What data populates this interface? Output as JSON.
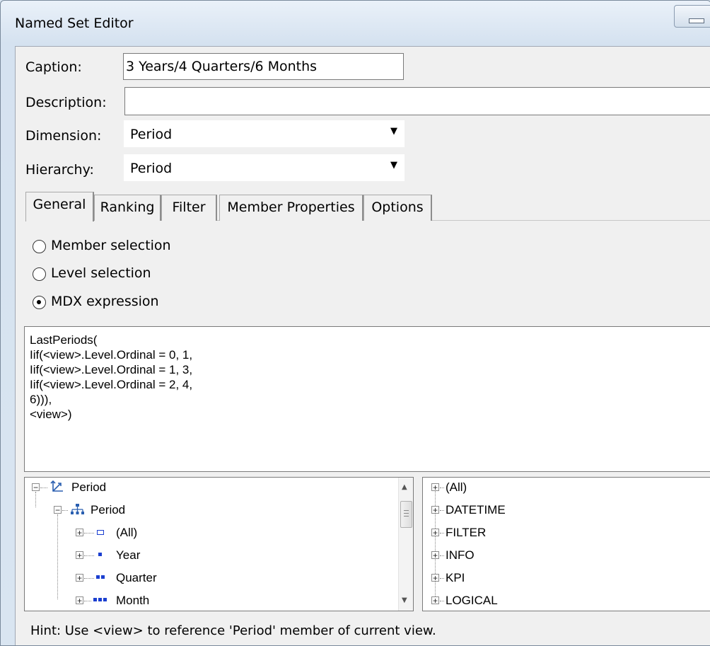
{
  "window": {
    "title": "Named Set Editor"
  },
  "form": {
    "caption_label": "Caption:",
    "caption_value": "3 Years/4 Quarters/6 Months",
    "description_label": "Description:",
    "description_value": "",
    "dimension_label": "Dimension:",
    "dimension_value": "Period",
    "hierarchy_label": "Hierarchy:",
    "hierarchy_value": "Period"
  },
  "tabs": [
    {
      "label": "General",
      "active": true
    },
    {
      "label": "Ranking",
      "active": false
    },
    {
      "label": "Filter",
      "active": false
    },
    {
      "label": "Member Properties",
      "active": false
    },
    {
      "label": "Options",
      "active": false
    }
  ],
  "selection_mode": {
    "options": [
      {
        "label": "Member selection",
        "checked": false
      },
      {
        "label": "Level selection",
        "checked": false
      },
      {
        "label": "MDX expression",
        "checked": true
      }
    ]
  },
  "mdx_expression": "LastPeriods(\nIif(<view>.Level.Ordinal = 0, 1,\nIif(<view>.Level.Ordinal = 1, 3,\nIif(<view>.Level.Ordinal = 2, 4,\n6))),\n<view>)",
  "member_tree": {
    "dimension": "Period",
    "hierarchy": "Period",
    "levels": [
      "(All)",
      "Year",
      "Quarter",
      "Month"
    ]
  },
  "function_tree": {
    "categories": [
      "(All)",
      "DATETIME",
      "FILTER",
      "INFO",
      "KPI",
      "LOGICAL"
    ]
  },
  "hint": "Hint: Use <view> to reference 'Period' member of current view."
}
